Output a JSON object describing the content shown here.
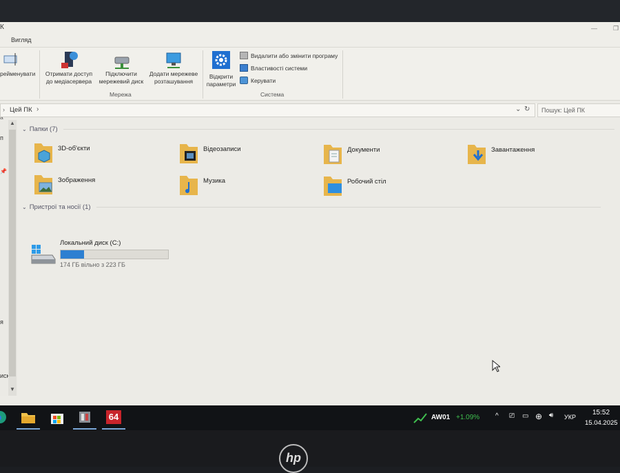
{
  "window": {
    "title_fragment": "К"
  },
  "tabs": {
    "view": "Вигляд"
  },
  "ribbon": {
    "rename": "рейменувати",
    "media_server": [
      "Отримати доступ",
      "до медіасервера"
    ],
    "map_drive": [
      "Підключити",
      "мережевий диск"
    ],
    "add_network": [
      "Додати мережеве",
      "розташування"
    ],
    "open_settings": [
      "Відкрити",
      "параметри"
    ],
    "uninstall": "Видалити або змінити програму",
    "system_props": "Властивості системи",
    "manage": "Керувати",
    "group_network": "Мережа",
    "group_system": "Система",
    "group_left": "а"
  },
  "address": {
    "path": "Цей ПК",
    "search_placeholder": "Пошук: Цей ПК"
  },
  "nav_fragments": [
    "п",
    "я",
    "иск"
  ],
  "folders_group": {
    "label": "Папки (7)"
  },
  "folders": [
    {
      "label": "3D-об'єкти",
      "icon": "3d-objects-folder-icon"
    },
    {
      "label": "Відеозаписи",
      "icon": "videos-folder-icon"
    },
    {
      "label": "Документи",
      "icon": "documents-folder-icon"
    },
    {
      "label": "Завантаження",
      "icon": "downloads-folder-icon"
    },
    {
      "label": "Зображення",
      "icon": "pictures-folder-icon"
    },
    {
      "label": "Музика",
      "icon": "music-folder-icon"
    },
    {
      "label": "Робочий стіл",
      "icon": "desktop-folder-icon"
    }
  ],
  "devices_group": {
    "label": "Пристрої та носії (1)"
  },
  "drive": {
    "name": "Локальний диск (C:)",
    "free_text": "174 ГБ вільно з 223 ГБ",
    "used_fraction": 0.22
  },
  "taskbar": {
    "stock_name": "AW01",
    "stock_change": "+1.09%",
    "stock_color": "#3fbf4f",
    "lang": "УКР",
    "time": "15:52",
    "date": "15.04.2025",
    "app64_label": "64"
  },
  "bezel": {
    "brand": "hp"
  }
}
